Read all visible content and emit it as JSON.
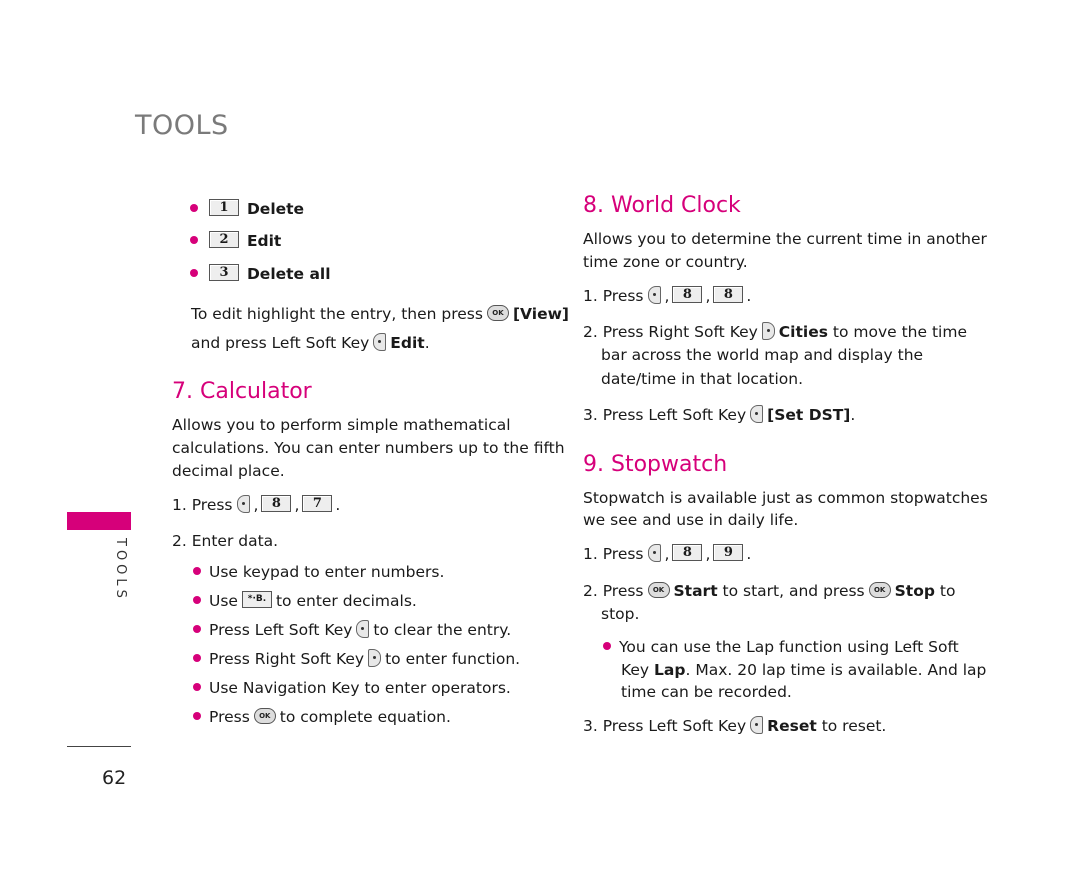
{
  "header": {
    "title": "TOOLS"
  },
  "side": {
    "label": "TOOLS",
    "accent": "#d6007a"
  },
  "footer": {
    "page_number": "62"
  },
  "left_column": {
    "options": [
      {
        "key": "1",
        "label": "Delete"
      },
      {
        "key": "2",
        "label": "Edit"
      },
      {
        "key": "3",
        "label": "Delete all"
      }
    ],
    "edit_line1_pre": "To edit highlight the entry, then press",
    "edit_line1_bold": "[View]",
    "edit_line2_pre": "and press Left Soft Key",
    "edit_line2_bold": "Edit",
    "edit_line2_post": ".",
    "calculator": {
      "title": "7. Calculator",
      "desc": [
        "Allows you to perform simple mathematical",
        "calculations. You can enter numbers up to the fifth",
        "decimal place."
      ],
      "step1_pre": "1. Press",
      "step1_keys": [
        "8",
        "7"
      ],
      "step2": "2. Enter data.",
      "b1": "Use keypad to enter numbers.",
      "b2_pre": "Use",
      "b2_key": "*·B.",
      "b2_post": "to enter decimals.",
      "b3_pre": "Press Left Soft Key",
      "b3_post": "to clear the entry.",
      "b4_pre": "Press Right Soft Key",
      "b4_post": "to enter function.",
      "b5": "Use Navigation Key to enter operators.",
      "b6_pre": "Press",
      "b6_post": "to complete equation."
    }
  },
  "right_column": {
    "world_clock": {
      "title": "8. World Clock",
      "desc": [
        "Allows you to determine the current time in another",
        "time zone or country."
      ],
      "step1_pre": "1. Press",
      "step1_keys": [
        "8",
        "8"
      ],
      "step2_pre": "2. Press Right Soft Key",
      "step2_bold": "Cities",
      "step2_post": "to move the time",
      "step2_l2": "bar across the world map and display the",
      "step2_l3": "date/time in that location.",
      "step3_pre": "3. Press Left Soft Key",
      "step3_bold": "[Set DST]"
    },
    "stopwatch": {
      "title": "9. Stopwatch",
      "desc": [
        "Stopwatch is available just as common stopwatches",
        "we see and use in daily life."
      ],
      "step1_pre": "1. Press",
      "step1_keys": [
        "8",
        "9"
      ],
      "step2_pre": "2. Press",
      "step2_bold1": "Start",
      "step2_mid": "to start, and press",
      "step2_bold2": "Stop",
      "step2_post": "to",
      "step2_l2": "stop.",
      "bullet_pre": "You can use the Lap function using Left Soft",
      "bullet_l2_pre": "Key",
      "bullet_l2_bold": "Lap",
      "bullet_l2_post": ". Max. 20 lap time is available. And lap",
      "bullet_l3": "time can be recorded.",
      "step3_pre": "3. Press Left Soft Key",
      "step3_bold": "Reset",
      "step3_post": "to reset."
    }
  },
  "icons": {
    "ok_label": "OK"
  }
}
